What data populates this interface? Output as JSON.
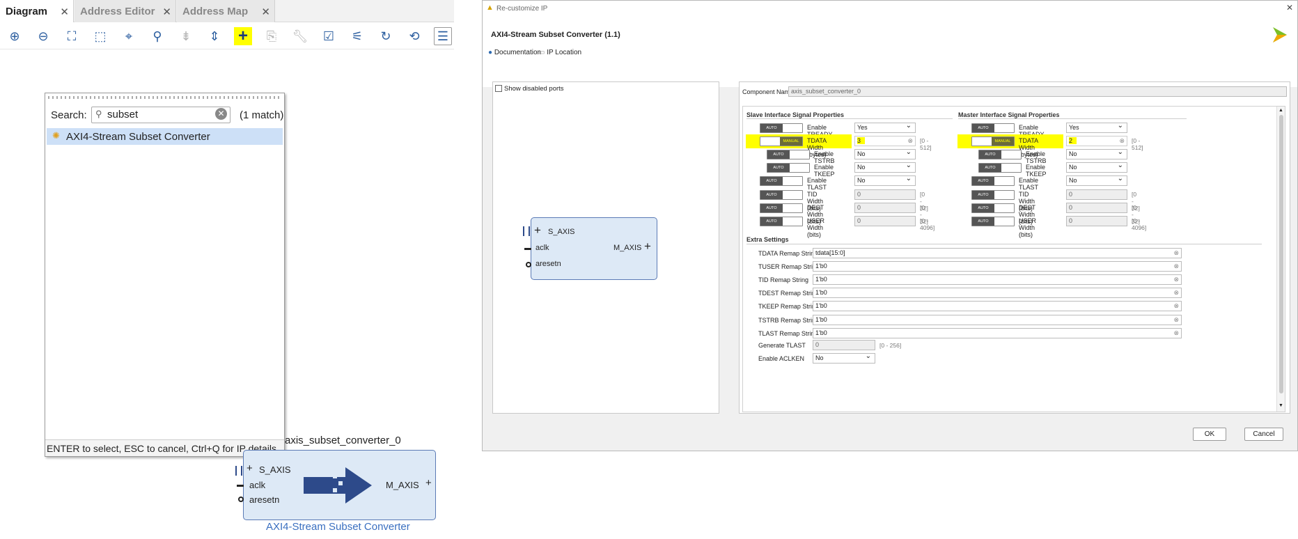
{
  "left_panel": {
    "tabs": [
      {
        "label": "Diagram",
        "close": "✕"
      },
      {
        "label": "Address Editor",
        "close": "✕"
      },
      {
        "label": "Address Map",
        "close": "✕"
      }
    ],
    "toolbar_icons": [
      "zoom-in-icon",
      "zoom-out-icon",
      "zoom-fit-icon",
      "zoom-area-icon",
      "center-icon",
      "search-icon",
      "collapse-icon",
      "expand-icon",
      "add-ip-icon",
      "add-module-icon",
      "properties-icon",
      "validate-icon",
      "pin-icon",
      "regenerate-icon",
      "optimize-icon",
      "menu-icon"
    ],
    "search_popup": {
      "search_label": "Search:",
      "query": "subset",
      "match_count": "(1 match)",
      "result": "AXI4-Stream Subset Converter",
      "footer": "ENTER to select, ESC to cancel, Ctrl+Q for IP details"
    },
    "block": {
      "instance_name": "axis_subset_converter_0",
      "ports_in": [
        "S_AXIS",
        "aclk",
        "aresetn"
      ],
      "port_out": "M_AXIS",
      "caption": "AXI4-Stream Subset Converter",
      "caption_color": "#3a6fc0"
    }
  },
  "dialog": {
    "window_title": "Re-customize IP",
    "close": "✕",
    "ip_title": "AXI4-Stream Subset Converter (1.1)",
    "links": [
      "Documentation",
      "IP Location"
    ],
    "show_disabled_ports": "Show disabled ports",
    "preview_block": {
      "ports_in": [
        "S_AXIS",
        "aclk",
        "aresetn"
      ],
      "port_out": "M_AXIS"
    },
    "component_name_label": "Component Name",
    "component_name": "axis_subset_converter_0",
    "slave_title": "Slave Interface Signal Properties",
    "master_title": "Master Interface Signal Properties",
    "slave_rows": [
      {
        "mode": "AUTO",
        "label": "Enable TREADY",
        "value": "Yes",
        "type": "select",
        "range": ""
      },
      {
        "mode": "MANUAL",
        "label": "TDATA Width (bytes)",
        "value": "3",
        "type": "input",
        "range": "[0 - 512]",
        "highlight": true
      },
      {
        "mode": "AUTO",
        "label": "Enable TSTRB",
        "value": "No",
        "type": "select",
        "range": ""
      },
      {
        "mode": "AUTO",
        "label": "Enable TKEEP",
        "value": "No",
        "type": "select",
        "range": ""
      },
      {
        "mode": "AUTO",
        "label": "Enable TLAST",
        "value": "No",
        "type": "select",
        "range": ""
      },
      {
        "mode": "AUTO",
        "label": "TID Width (bits)",
        "value": "0",
        "type": "disabled",
        "range": "[0 - 32]"
      },
      {
        "mode": "AUTO",
        "label": "DEST Width (bits)",
        "value": "0",
        "type": "disabled",
        "range": "[0 - 32]"
      },
      {
        "mode": "AUTO",
        "label": "USER Width (bits)",
        "value": "0",
        "type": "disabled",
        "range": "[0 - 4096]"
      }
    ],
    "master_rows": [
      {
        "mode": "AUTO",
        "label": "Enable TREADY",
        "value": "Yes",
        "type": "select",
        "range": ""
      },
      {
        "mode": "MANUAL",
        "label": "TDATA Width (bytes)",
        "value": "2",
        "type": "input",
        "range": "[0 - 512]",
        "highlight": true
      },
      {
        "mode": "AUTO",
        "label": "Enable TSTRB",
        "value": "No",
        "type": "select",
        "range": ""
      },
      {
        "mode": "AUTO",
        "label": "Enable TKEEP",
        "value": "No",
        "type": "select",
        "range": ""
      },
      {
        "mode": "AUTO",
        "label": "Enable TLAST",
        "value": "No",
        "type": "select",
        "range": ""
      },
      {
        "mode": "AUTO",
        "label": "TID Width (bits)",
        "value": "0",
        "type": "disabled",
        "range": "[0 - 32]"
      },
      {
        "mode": "AUTO",
        "label": "DEST Width (bits)",
        "value": "0",
        "type": "disabled",
        "range": "[0 - 32]"
      },
      {
        "mode": "AUTO",
        "label": "USER Width (bits)",
        "value": "0",
        "type": "disabled",
        "range": "[0 - 4096]"
      }
    ],
    "extra_title": "Extra Settings",
    "remap_rows": [
      {
        "label": "TDATA Remap String",
        "value": "tdata[15:0]"
      },
      {
        "label": "TUSER Remap String",
        "value": "1'b0"
      },
      {
        "label": "TID Remap String",
        "value": "1'b0"
      },
      {
        "label": "TDEST Remap String",
        "value": "1'b0"
      },
      {
        "label": "TKEEP Remap String",
        "value": "1'b0"
      },
      {
        "label": "TSTRB Remap String",
        "value": "1'b0"
      },
      {
        "label": "TLAST Remap String",
        "value": "1'b0"
      }
    ],
    "generate_tlast": {
      "label": "Generate TLAST",
      "value": "0",
      "range": "[0 - 256]"
    },
    "enable_aclken": {
      "label": "Enable ACLKEN",
      "value": "No"
    },
    "ok": "OK",
    "cancel": "Cancel",
    "highlight_color": "#ffff00"
  }
}
